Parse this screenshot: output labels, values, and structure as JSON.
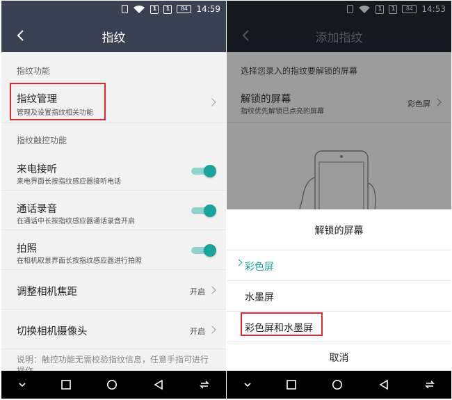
{
  "status_bar": {
    "battery": "84",
    "time_left": "14:59",
    "time_right": "14:53"
  },
  "left": {
    "title": "指纹",
    "section1": "指纹功能",
    "fp_manage": {
      "title": "指纹管理",
      "subtitle": "管理及设置指纹相关功能"
    },
    "section2": "指纹触控功能",
    "toggles": [
      {
        "title": "来电接听",
        "subtitle": "来电界面长按指纹感应器接听电话",
        "on": true
      },
      {
        "title": "通话录音",
        "subtitle": "在通话中长按指纹感应器通话录音开启",
        "on": true
      },
      {
        "title": "拍照",
        "subtitle": "在相机取景界面长按指纹感应器进行拍照",
        "on": true
      }
    ],
    "focus": {
      "title": "调整相机焦距",
      "status": "开启"
    },
    "switch_cam": {
      "title": "切换相机摄像头",
      "status": "开启"
    },
    "note": "说明：触控功能无需校验指纹信息，任意手指可进行操作"
  },
  "right": {
    "title": "添加指纹",
    "prompt": "选择您录入的指纹要解锁的屏幕",
    "unlock_row": {
      "title": "解锁的屏幕",
      "subtitle": "指纹优先解锁已点亮的屏幕",
      "value": "彩色屏"
    },
    "sheet": {
      "title": "解锁的屏幕",
      "options": [
        "彩色屏",
        "水墨屏",
        "彩色屏和水墨屏"
      ],
      "selected": 0,
      "cancel": "取消"
    }
  },
  "colors": {
    "accent": "#1aa39a",
    "titlebar": "#394152",
    "highlight": "#e3262b"
  },
  "icons": [
    "back-icon",
    "chevron-right-icon",
    "wifi-icon",
    "battery-icon",
    "nav-down-icon",
    "nav-home-icon",
    "nav-back-icon",
    "nav-switch-icon"
  ]
}
